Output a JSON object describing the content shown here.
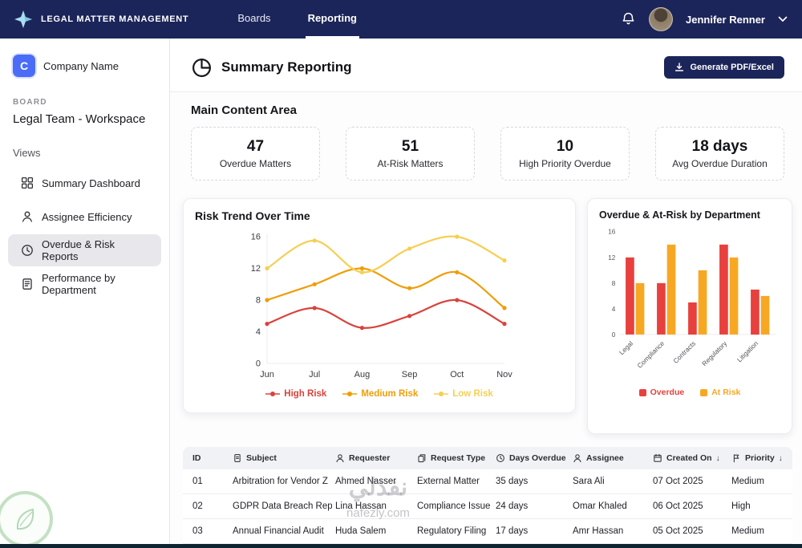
{
  "navbar": {
    "brand": "LEGAL MATTER MANAGEMENT",
    "tabs": [
      {
        "label": "Boards",
        "active": false
      },
      {
        "label": "Reporting",
        "active": true
      }
    ],
    "user_name": "Jennifer Renner"
  },
  "sidebar": {
    "company_initial": "C",
    "company_name": "Company Name",
    "board_label": "BOARD",
    "board_name": "Legal Team - Workspace",
    "views_label": "Views",
    "items": [
      {
        "label": "Summary Dashboard",
        "icon": "grid-icon",
        "active": false
      },
      {
        "label": "Assignee Efficiency",
        "icon": "person-icon",
        "active": false
      },
      {
        "label": "Overdue & Risk Reports",
        "icon": "clock-icon",
        "active": true
      },
      {
        "label": "Performance by Department",
        "icon": "report-icon",
        "active": false
      }
    ]
  },
  "header": {
    "title": "Summary Reporting",
    "generate_button": "Generate PDF/Excel"
  },
  "main": {
    "section_title": "Main Content Area",
    "stats": [
      {
        "value": "47",
        "label": "Overdue Matters"
      },
      {
        "value": "51",
        "label": "At-Risk Matters"
      },
      {
        "value": "10",
        "label": "High Priority Overdue"
      },
      {
        "value": "18 days",
        "label": "Avg Overdue Duration"
      }
    ]
  },
  "chart_data": [
    {
      "type": "line",
      "title": "Risk Trend Over Time",
      "x": [
        "Jun",
        "Jul",
        "Aug",
        "Sep",
        "Oct",
        "Nov"
      ],
      "series": [
        {
          "name": "High Risk",
          "color": "#d8433c",
          "values": [
            5,
            7,
            4.5,
            6,
            8,
            5
          ]
        },
        {
          "name": "Medium Risk",
          "color": "#f09d07",
          "values": [
            8,
            10,
            12,
            9.5,
            11.5,
            7
          ]
        },
        {
          "name": "Low Risk",
          "color": "#f6cf53",
          "values": [
            12,
            15.5,
            11.5,
            14.5,
            16,
            13
          ]
        }
      ],
      "ylim": [
        0,
        16
      ],
      "yticks": [
        0,
        4,
        8,
        12,
        16
      ],
      "grid": false,
      "legend_position": "bottom"
    },
    {
      "type": "bar",
      "title": "Overdue & At-Risk by Department",
      "categories": [
        "Legal",
        "Compliance",
        "Contracts",
        "Regulatory",
        "Litigation"
      ],
      "series": [
        {
          "name": "Overdue",
          "color": "#e8403d",
          "values": [
            12,
            8,
            5,
            14,
            7
          ]
        },
        {
          "name": "At Risk",
          "color": "#f7a823",
          "values": [
            8,
            14,
            10,
            12,
            6
          ]
        }
      ],
      "ylim": [
        0,
        16
      ],
      "yticks": [
        0,
        4,
        8,
        12,
        16
      ],
      "grid": false,
      "legend_position": "bottom"
    }
  ],
  "table": {
    "columns": [
      {
        "label": "ID",
        "icon": "none",
        "sortable": false
      },
      {
        "label": "Subject",
        "icon": "doc",
        "sortable": false
      },
      {
        "label": "Requester",
        "icon": "person",
        "sortable": false
      },
      {
        "label": "Request Type",
        "icon": "copy",
        "sortable": false
      },
      {
        "label": "Days Overdue",
        "icon": "clock",
        "sortable": false
      },
      {
        "label": "Assignee",
        "icon": "person",
        "sortable": false
      },
      {
        "label": "Created On",
        "icon": "calendar",
        "sortable": true
      },
      {
        "label": "Priority",
        "icon": "flag",
        "sortable": true
      }
    ],
    "rows": [
      [
        "01",
        "Arbitration for Vendor Z",
        "Ahmed Nasser",
        "External Matter",
        "35 days",
        "Sara Ali",
        "07 Oct 2025",
        "Medium"
      ],
      [
        "02",
        "GDPR Data Breach Report",
        "Lina Hassan",
        "Compliance Issue",
        "24 days",
        "Omar Khaled",
        "06 Oct 2025",
        "High"
      ],
      [
        "03",
        "Annual Financial Audit",
        "Huda Salem",
        "Regulatory Filing",
        "17 days",
        "Amr Hassan",
        "05 Oct 2025",
        "Medium"
      ]
    ]
  },
  "watermark": {
    "arabic": "نفذلي",
    "site": "nafezly.com"
  }
}
